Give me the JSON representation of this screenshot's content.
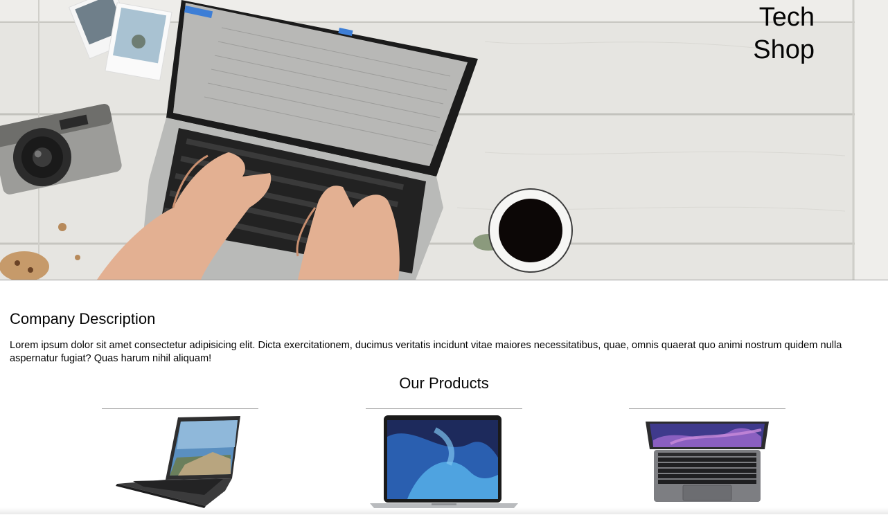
{
  "header": {
    "brand_line1": "Tech",
    "brand_line2": "Shop"
  },
  "about": {
    "title": "Company Description",
    "text": "Lorem ipsum dolor sit amet consectetur adipisicing elit. Dicta exercitationem, ducimus veritatis incidunt vitae maiores necessitatibus, quae, omnis quaerat quo animi nostrum quidem nulla aspernatur fugiat? Quas harum nihil aliquam!"
  },
  "products": {
    "title": "Our Products",
    "items": [
      {
        "image": "hp-laptop-image"
      },
      {
        "image": "macbook-air-image"
      },
      {
        "image": "macbook-pro-image"
      }
    ]
  },
  "colors": {
    "text": "#050505",
    "divider": "#9a9a9a",
    "background": "#ffffff"
  }
}
